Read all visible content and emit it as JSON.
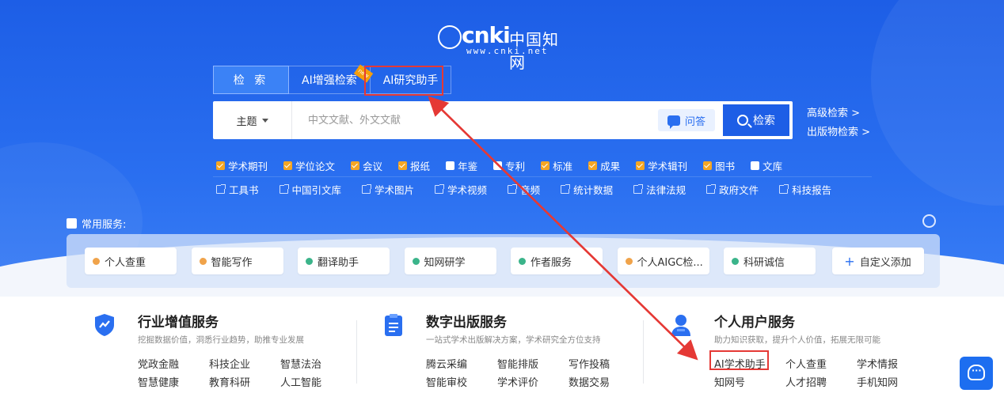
{
  "logo": {
    "brand": "cnki",
    "brand_cn": "中国知网",
    "url": "www.cnki.net"
  },
  "tabs": [
    {
      "label": "检 索"
    },
    {
      "label": "AI增强检索",
      "badge": "new"
    },
    {
      "label": "AI研究助手"
    }
  ],
  "search": {
    "field": "主题",
    "placeholder": "中文文献、外文文献",
    "ask_label": "问答",
    "button_label": "检索"
  },
  "side_links": [
    "高级检索 >",
    "出版物检索 >"
  ],
  "checkboxes": [
    {
      "label": "学术期刊",
      "checked": true
    },
    {
      "label": "学位论文",
      "checked": true
    },
    {
      "label": "会议",
      "checked": true
    },
    {
      "label": "报纸",
      "checked": true
    },
    {
      "label": "年鉴",
      "checked": false
    },
    {
      "label": "专利",
      "checked": false
    },
    {
      "label": "标准",
      "checked": true
    },
    {
      "label": "成果",
      "checked": true
    },
    {
      "label": "学术辑刊",
      "checked": true
    },
    {
      "label": "图书",
      "checked": true
    },
    {
      "label": "文库",
      "checked": false
    }
  ],
  "resource_links": [
    "工具书",
    "中国引文库",
    "学术图片",
    "学术视频",
    "音频",
    "统计数据",
    "法律法规",
    "政府文件",
    "科技报告"
  ],
  "common": {
    "title": "常用服务:",
    "items": [
      {
        "label": "个人查重",
        "color": "#f0a34a"
      },
      {
        "label": "智能写作",
        "color": "#f0a34a"
      },
      {
        "label": "翻译助手",
        "color": "#3bb48a"
      },
      {
        "label": "知网研学",
        "color": "#3bb48a"
      },
      {
        "label": "作者服务",
        "color": "#3bb48a"
      },
      {
        "label": "个人AIGC检...",
        "color": "#f0a34a"
      },
      {
        "label": "科研诚信",
        "color": "#3bb48a"
      }
    ],
    "add_label": "自定义添加"
  },
  "columns": [
    {
      "title": "行业增值服务",
      "desc": "挖掘数据价值，洞悉行业趋势，助推专业发展",
      "items": [
        "党政金融",
        "科技企业",
        "智慧法治",
        "智慧健康",
        "教育科研",
        "人工智能"
      ]
    },
    {
      "title": "数字出版服务",
      "desc": "一站式学术出版解决方案，学术研究全方位支持",
      "items": [
        "腾云采编",
        "智能排版",
        "写作投稿",
        "智能审校",
        "学术评价",
        "数据交易"
      ]
    },
    {
      "title": "个人用户服务",
      "desc": "助力知识获取，提升个人价值，拓展无限可能",
      "items": [
        "AI学术助手",
        "个人查重",
        "学术情报",
        "知网号",
        "人才招聘",
        "手机知网"
      ]
    }
  ],
  "colors": {
    "hero": "#2a6ff0",
    "accent": "#1d5ee6",
    "highlight": "#e53935",
    "check": "#f5a623"
  }
}
